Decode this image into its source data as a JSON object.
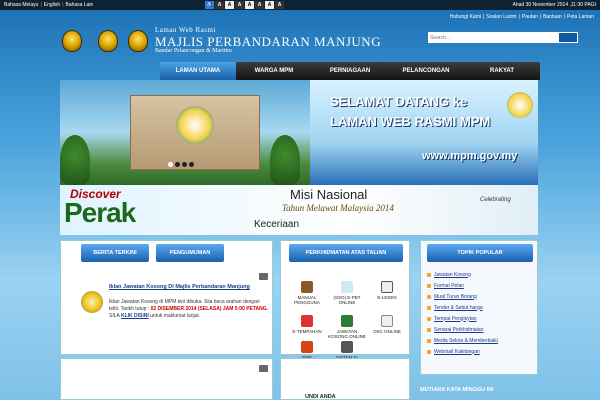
{
  "topbar": {
    "lang_links": [
      "Bahasa Melayu",
      "English",
      "Bahasa Lain"
    ],
    "access_buttons": [
      "A",
      "A",
      "A",
      "A",
      "A",
      "A",
      "A"
    ],
    "date": "Ahad 30 November 2014 ,11:30 PAGI"
  },
  "header": {
    "subtitle": "Laman Web Rasmi",
    "title": "MAJLIS PERBANDARAN MANJUNG",
    "tagline": "Bandar Pelancongan & Maritim",
    "top_links": [
      "Hubungi Kami",
      "Soalan Lazim",
      "Pautan",
      "Bantuan",
      "Peta Laman"
    ],
    "search_placeholder": "Search..."
  },
  "nav": {
    "items": [
      "LAMAN UTAMA",
      "WARGA MPM",
      "PERNIAGAAN",
      "PELANCONGAN",
      "RAKYAT"
    ]
  },
  "banner": {
    "welcome_line1": "SELAMAT DATANG ke",
    "welcome_line2": "LAMAN WEB RASMI MPM",
    "url": "www.mpm.gov.my"
  },
  "misi": {
    "discover": "Discover",
    "perak": "Perak",
    "title": "Misi Nasional",
    "subtitle": "Tahun Melawat Malaysia 2014",
    "keceriaan": "Keceriaan",
    "celebrating": "Celebrating"
  },
  "news": {
    "tab1": "BERITA TERKINI",
    "tab2": "PENGUMUMAN",
    "title": "Iklan Jawatan Kosong Di Majlis Perbandaran Manjung",
    "body_part1": "Iklan Jawatan Kosong di MPM kini dibuka. Sila baca arahan dengan teliti. Tarikh tutup :",
    "body_date": "02 DISEMBER 2014 (SELASA) JAM 5:00 PETANG.",
    "body_part2": "SILA",
    "body_link": "KLIK DISINI",
    "body_part3": "untuk maklumat lanjut."
  },
  "services": {
    "header": "PERKHIDMATAN ATAS TALIAN",
    "items": [
      "MANUAL PENGGUNA",
      "(SSO) E-PBT ONLINE",
      "E-LESEN",
      "E-TEMPAHAN",
      "JAWATAN KOSONG ONLINE",
      "OSC ONLINE",
      "FMS",
      "SISTEM E-BAYARAN"
    ]
  },
  "topik": {
    "header": "TOPIK POPULAR",
    "items": [
      "Jawatan Kosong",
      "Format Pelan",
      "Muat Turun Borang",
      "Tender & Sebut harga",
      "Tempat Pengisytan",
      "Senarai Perkhidmatan",
      "Media Sekira & Memberbaiki",
      "Webmail Kakitangan"
    ]
  },
  "footer": {
    "mutiara": "MUTIARA KATA MINGGU INI",
    "undi": "UNDI ANDA"
  },
  "colors": {
    "accent": "#1a5fb0",
    "topbar": "#0d2233",
    "link": "#1a3c8a",
    "alert": "#cc0000"
  }
}
